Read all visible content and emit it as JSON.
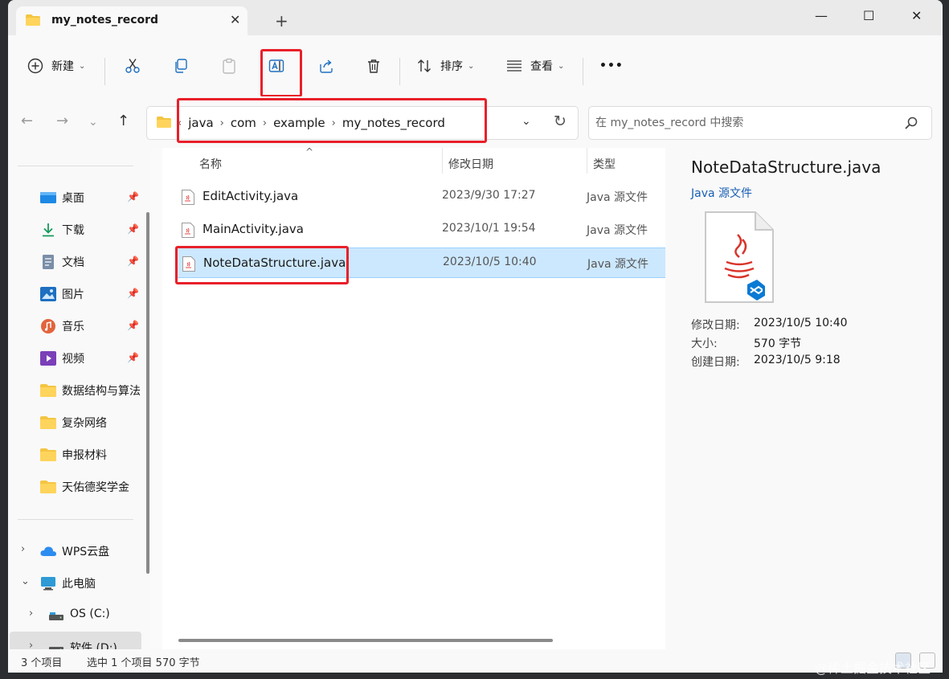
{
  "window": {
    "tab_title": "my_notes_record",
    "tab_close": "✕",
    "new_tab": "+",
    "minimize": "—",
    "maximize": "☐",
    "close": "✕"
  },
  "toolbar": {
    "new_label": "新建",
    "sort_label": "排序",
    "view_label": "查看",
    "more": "•••",
    "highlight_button": "rename-icon"
  },
  "address": {
    "crumbs": [
      "java",
      "com",
      "example",
      "my_notes_record"
    ],
    "separator": "›",
    "leading": "‹"
  },
  "search": {
    "placeholder": "在 my_notes_record 中搜索"
  },
  "sidebar": {
    "quick_access": [
      {
        "label": "桌面",
        "icon": "desktop-icon",
        "pinned": true
      },
      {
        "label": "下载",
        "icon": "download-icon",
        "pinned": true
      },
      {
        "label": "文档",
        "icon": "documents-icon",
        "pinned": true
      },
      {
        "label": "图片",
        "icon": "pictures-icon",
        "pinned": true
      },
      {
        "label": "音乐",
        "icon": "music-icon",
        "pinned": true
      },
      {
        "label": "视频",
        "icon": "videos-icon",
        "pinned": true
      },
      {
        "label": "数据结构与算法",
        "icon": "folder-icon",
        "pinned": false
      },
      {
        "label": "复杂网络",
        "icon": "folder-icon",
        "pinned": false
      },
      {
        "label": "申报材料",
        "icon": "folder-icon",
        "pinned": false
      },
      {
        "label": "天佑德奖学金",
        "icon": "folder-icon",
        "pinned": false
      }
    ],
    "tree": [
      {
        "label": "WPS云盘",
        "icon": "cloud-icon",
        "expander": "›"
      },
      {
        "label": "此电脑",
        "icon": "pc-icon",
        "expander": "⌄"
      },
      {
        "label": "OS (C:)",
        "icon": "drive-icon",
        "expander": "›"
      },
      {
        "label": "软件 (D:)",
        "icon": "drive-icon",
        "expander": "›"
      }
    ]
  },
  "columns": {
    "name": "名称",
    "date": "修改日期",
    "type": "类型"
  },
  "files": [
    {
      "name": "EditActivity.java",
      "date": "2023/9/30 17:27",
      "type": "Java 源文件"
    },
    {
      "name": "MainActivity.java",
      "date": "2023/10/1 19:54",
      "type": "Java 源文件"
    },
    {
      "name": "NoteDataStructure.java",
      "date": "2023/10/5 10:40",
      "type": "Java 源文件"
    }
  ],
  "preview": {
    "title": "NoteDataStructure.java",
    "subtitle": "Java 源文件",
    "props": [
      {
        "label": "修改日期:",
        "value": "2023/10/5 10:40"
      },
      {
        "label": "大小:",
        "value": "570 字节"
      },
      {
        "label": "创建日期:",
        "value": "2023/10/5 9:18"
      }
    ]
  },
  "status": {
    "count": "3 个项目",
    "selection": "选中 1 个项目  570 字节"
  },
  "watermark": "@稀土掘金技术社区",
  "colors": {
    "accent": "#0067c0",
    "selection": "#cce8ff",
    "annotation_red": "#e8202a"
  }
}
